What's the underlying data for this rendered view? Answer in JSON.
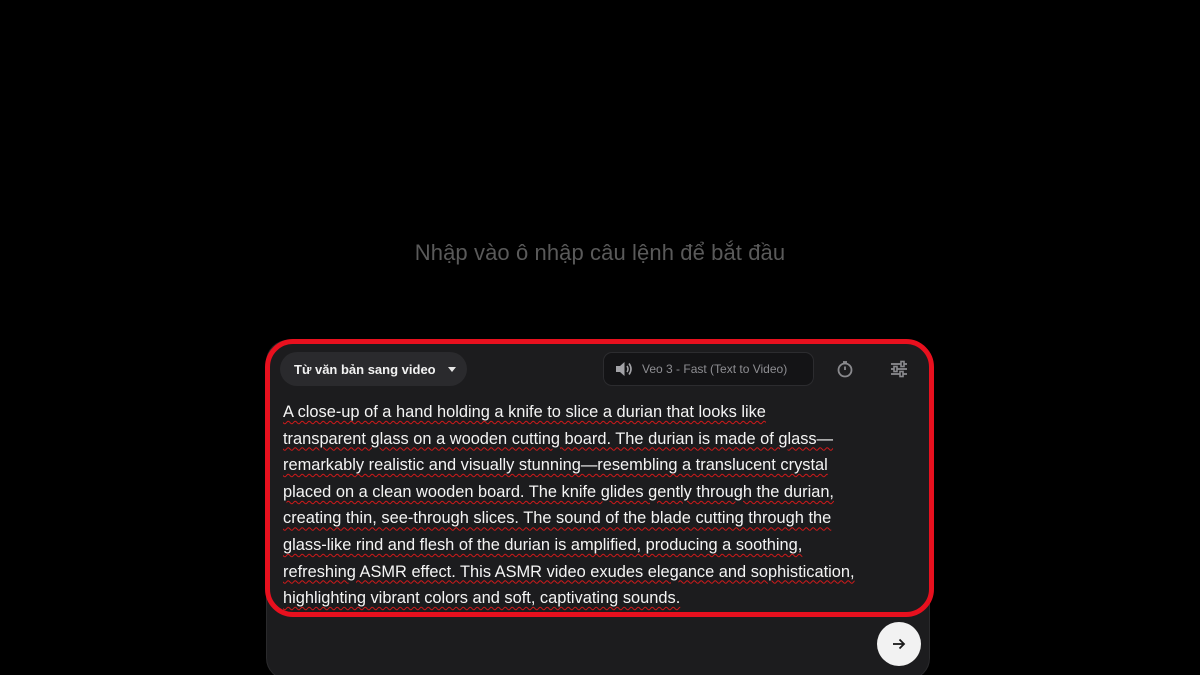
{
  "empty_state": {
    "hint": "Nhập vào ô nhập câu lệnh để bắt đầu"
  },
  "composer": {
    "mode_selector": {
      "label": "Từ văn bản sang video",
      "icon": "chevron-down-icon"
    },
    "model": {
      "label": "Veo 3 - Fast (Text to Video)",
      "icon": "speaker-icon"
    },
    "toolbar_icons": [
      "timer-icon",
      "sliders-icon"
    ],
    "prompt": "A close-up of a hand holding a knife to slice a durian that looks like\ntransparent glass on a wooden cutting board. The durian is made of glass—\nremarkably realistic and visually stunning—resembling a translucent crystal\nplaced on a clean wooden board. The knife glides gently through the durian,\ncreating thin, see-through slices. The sound of the blade cutting through the\nglass-like rind and flesh of the durian is amplified, producing a soothing,\nrefreshing ASMR effect. This ASMR video exudes elegance and sophistication,\nhighlighting vibrant colors and soft, captivating sounds.",
    "send_icon": "arrow-right-icon"
  },
  "colors": {
    "background": "#000000",
    "panel": "#1c1c1e",
    "highlight": "#e8101e",
    "spellcheck": "#d11a1a"
  }
}
